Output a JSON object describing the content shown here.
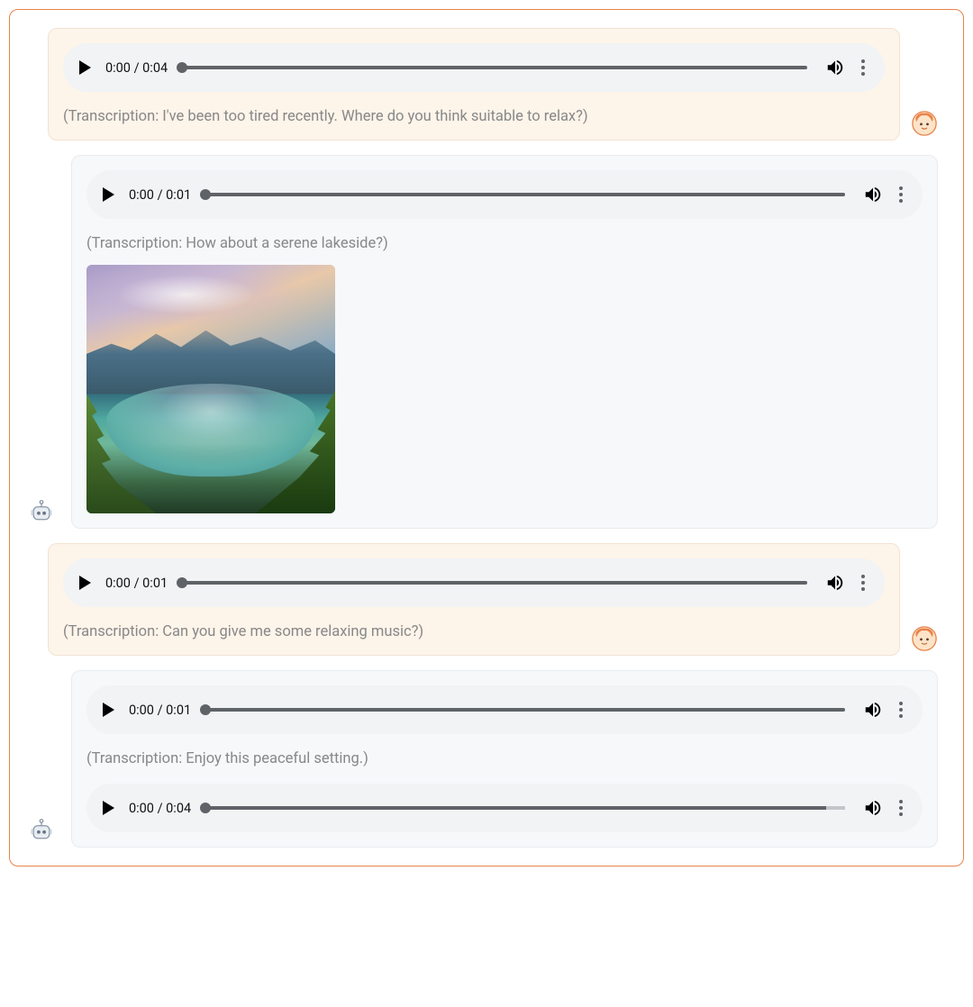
{
  "messages": [
    {
      "role": "user",
      "audio": {
        "current": "0:00",
        "duration": "0:04"
      },
      "transcription": "(Transcription: I've been too tired recently. Where do you think suitable to relax?)"
    },
    {
      "role": "bot",
      "audio": {
        "current": "0:00",
        "duration": "0:01"
      },
      "transcription": "(Transcription: How about a serene lakeside?)",
      "image_desc": "serene-lakeside"
    },
    {
      "role": "user",
      "audio": {
        "current": "0:00",
        "duration": "0:01"
      },
      "transcription": "(Transcription: Can you give me some relaxing music?)"
    },
    {
      "role": "bot",
      "audio": {
        "current": "0:00",
        "duration": "0:01"
      },
      "transcription": "(Transcription: Enjoy this peaceful setting.)",
      "audio2": {
        "current": "0:00",
        "duration": "0:04"
      }
    }
  ]
}
